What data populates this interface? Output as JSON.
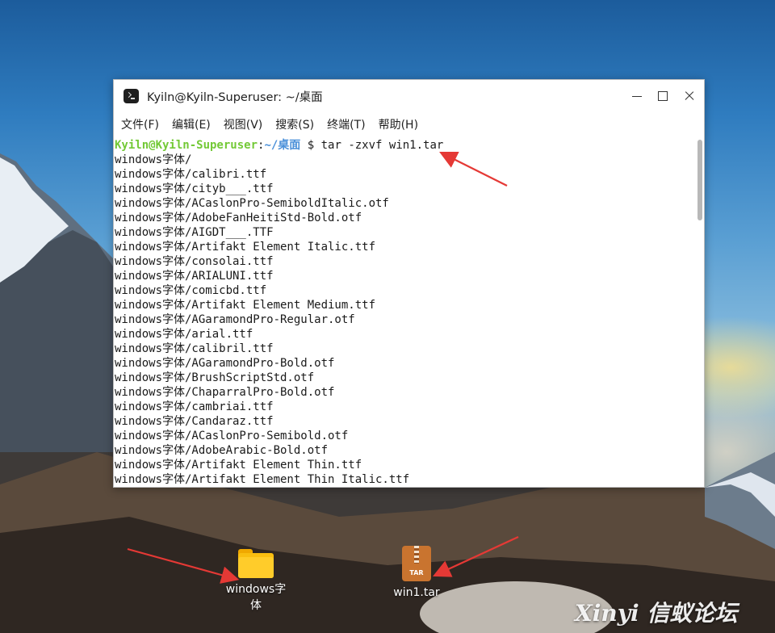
{
  "window": {
    "title": "Kyiln@Kyiln-Superuser: ~/桌面"
  },
  "menu": [
    "文件(F)",
    "编辑(E)",
    "视图(V)",
    "搜索(S)",
    "终端(T)",
    "帮助(H)"
  ],
  "terminal": {
    "prompt_user": "Kyiln@Kyiln-Superuser",
    "prompt_sep": ":",
    "prompt_path": "~/桌面",
    "command": "$ tar -zxvf win1.tar",
    "output": [
      "windows字体/",
      "windows字体/calibri.ttf",
      "windows字体/cityb___.ttf",
      "windows字体/ACaslonPro-SemiboldItalic.otf",
      "windows字体/AdobeFanHeitiStd-Bold.otf",
      "windows字体/AIGDT___.TTF",
      "windows字体/Artifakt Element Italic.ttf",
      "windows字体/consolai.ttf",
      "windows字体/ARIALUNI.ttf",
      "windows字体/comicbd.ttf",
      "windows字体/Artifakt Element Medium.ttf",
      "windows字体/AGaramondPro-Regular.otf",
      "windows字体/arial.ttf",
      "windows字体/calibril.ttf",
      "windows字体/AGaramondPro-Bold.otf",
      "windows字体/BrushScriptStd.otf",
      "windows字体/ChaparralPro-Bold.otf",
      "windows字体/cambriai.ttf",
      "windows字体/Candaraz.ttf",
      "windows字体/ACaslonPro-Semibold.otf",
      "windows字体/AdobeArabic-Bold.otf",
      "windows字体/Artifakt Element Thin.ttf",
      "windows字体/Artifakt Element Thin Italic.ttf"
    ]
  },
  "desktop": {
    "folder_label_line1": "windows字",
    "folder_label_line2": "体",
    "tar_label": "win1.tar",
    "tar_tag": "TAR"
  },
  "watermark": "Xinyi 信蚁论坛",
  "colors": {
    "prompt_user": "#73c936",
    "prompt_path": "#4a90d9",
    "arrow": "#e53935"
  }
}
